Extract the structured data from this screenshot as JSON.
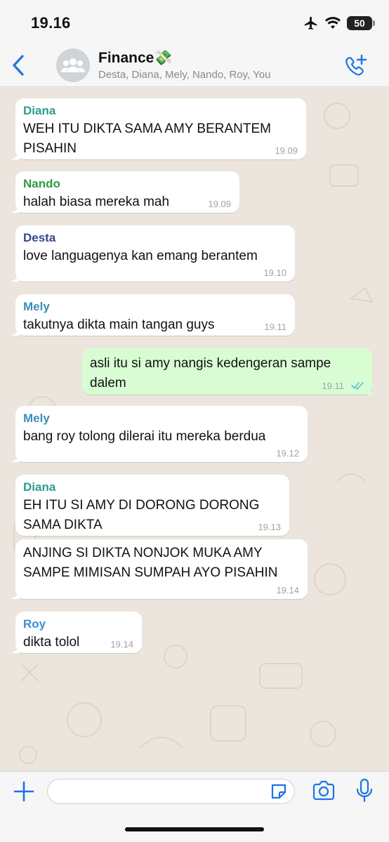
{
  "status_bar": {
    "time": "19.16",
    "battery": "50"
  },
  "header": {
    "title": "Finance💸",
    "subtitle": "Desta, Diana, Mely, Nando, Roy, You"
  },
  "colors": {
    "accent": "#1a73e8",
    "diana": "#2a9d8f",
    "nando": "#2f9a3e",
    "desta": "#334a8c",
    "mely": "#3a8fb7",
    "roy": "#3a8fd6",
    "outgoing_bubble": "#d9fdd3",
    "read_ticks": "#53bdeb"
  },
  "messages": [
    {
      "sender": "Diana",
      "text": "WEH ITU DIKTA SAMA AMY BERANTEM\nPISAHIN",
      "time": "19.09",
      "direction": "in"
    },
    {
      "sender": "Nando",
      "text": "halah biasa mereka mah",
      "time": "19.09",
      "direction": "in"
    },
    {
      "sender": "Desta",
      "text": "love languagenya kan emang berantem",
      "time": "19.10",
      "direction": "in"
    },
    {
      "sender": "Mely",
      "text": "takutnya dikta main tangan guys",
      "time": "19.11",
      "direction": "in"
    },
    {
      "sender": "",
      "text": "asli itu si amy nangis kedengeran sampe\ndalem",
      "time": "19.11",
      "direction": "out",
      "status": "read"
    },
    {
      "sender": "Mely",
      "text": "bang roy tolong dilerai itu mereka berdua",
      "time": "19.12",
      "direction": "in"
    },
    {
      "sender": "Diana",
      "text": "EH ITU SI AMY DI DORONG DORONG\nSAMA DIKTA",
      "time": "19.13",
      "direction": "in"
    },
    {
      "sender": "",
      "text": "ANJING SI DIKTA NONJOK MUKA AMY\nSAMPE MIMISAN SUMPAH AYO PISAHIN",
      "time": "19.14",
      "direction": "in"
    },
    {
      "sender": "Roy",
      "text": "dikta tolol",
      "time": "19.14",
      "direction": "in"
    }
  ],
  "composer": {
    "value": "",
    "placeholder": ""
  }
}
